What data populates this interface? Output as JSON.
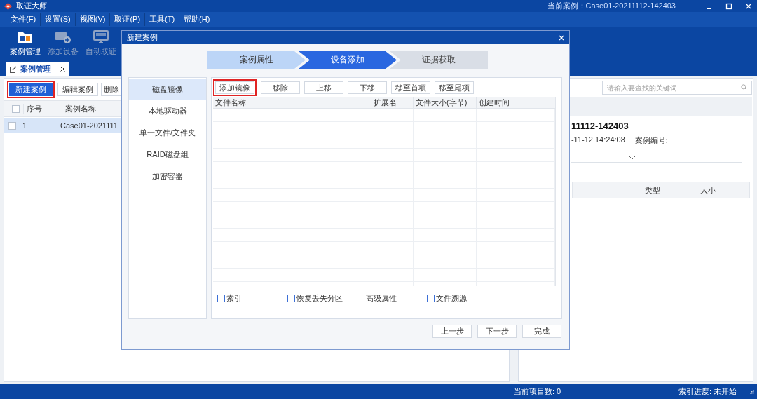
{
  "window": {
    "title": "取证大师",
    "current_case": "当前案例：Case01-20211112-142403"
  },
  "menu": [
    "文件(F)",
    "设置(S)",
    "视图(V)",
    "取证(P)",
    "工具(T)",
    "帮助(H)"
  ],
  "toolbar": [
    {
      "label": "案例管理",
      "kind": "folder",
      "disabled": false
    },
    {
      "label": "添加设备",
      "kind": "device",
      "disabled": true
    },
    {
      "label": "自动取证",
      "kind": "monitor",
      "disabled": true
    }
  ],
  "tabs": [
    {
      "label": "案例管理",
      "selected": true
    }
  ],
  "case_panel": {
    "buttons": [
      {
        "label": "新建案例",
        "selected": true,
        "highlighted": true
      },
      {
        "label": "编辑案例",
        "selected": false,
        "highlighted": false
      },
      {
        "label": "删除",
        "selected": false,
        "highlighted": false
      }
    ],
    "select_all_checked": false,
    "columns": [
      "序号",
      "案例名称"
    ],
    "rows": [
      {
        "index": "1",
        "name": "Case01-2021111",
        "selected": true,
        "checked": false
      }
    ]
  },
  "detail_panel": {
    "search": {
      "placeholder": "请输入要查找的关键词"
    },
    "case_title": "11112-142403",
    "created": "-11-12 14:24:08",
    "case_number_label": "案例编号:",
    "columns": [
      "类型",
      "大小"
    ]
  },
  "dialog": {
    "title": "新建案例",
    "steps": [
      {
        "label": "案例属性",
        "selected": false
      },
      {
        "label": "设备添加",
        "selected": true
      },
      {
        "label": "证据获取",
        "selected": false
      }
    ],
    "sources": [
      {
        "label": "磁盘镜像",
        "selected": true
      },
      {
        "label": "本地驱动器",
        "selected": false
      },
      {
        "label": "单一文件/文件夹",
        "selected": false
      },
      {
        "label": "RAID磁盘组",
        "selected": false
      },
      {
        "label": "加密容器",
        "selected": false
      }
    ],
    "buttons": [
      {
        "label": "添加镜像",
        "highlighted": true
      },
      {
        "label": "移除",
        "highlighted": false
      },
      {
        "label": "上移",
        "highlighted": false
      },
      {
        "label": "下移",
        "highlighted": false
      },
      {
        "label": "移至首项",
        "highlighted": false
      },
      {
        "label": "移至尾项",
        "highlighted": false
      }
    ],
    "columns": [
      "文件名称",
      "扩展名",
      "文件大小(字节)",
      "创建时间"
    ],
    "options": [
      {
        "label": "索引",
        "checked": false
      },
      {
        "label": "恢复丢失分区",
        "checked": false
      },
      {
        "label": "高级属性",
        "checked": false
      },
      {
        "label": "文件溯源",
        "checked": false
      }
    ],
    "footer_buttons": [
      "上一步",
      "下一步",
      "完成"
    ]
  },
  "status_bar": {
    "item_count": "当前项目数: 0",
    "index_progress": "索引进度: 未开始"
  }
}
